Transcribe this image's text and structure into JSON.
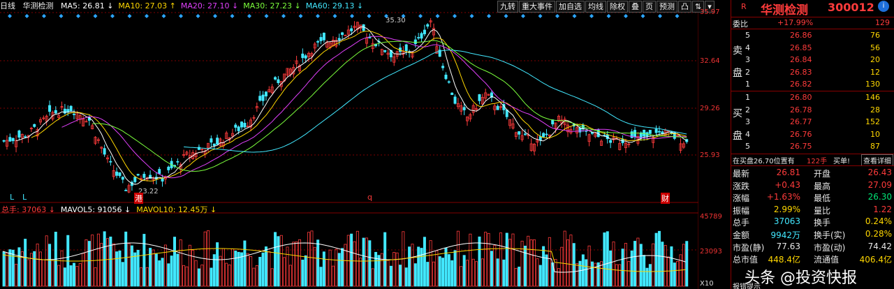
{
  "header": {
    "period": "日线",
    "name": "华测检测",
    "ma": [
      {
        "label": "MA5: 26.81",
        "arrow": "↓",
        "color": "#ffffff"
      },
      {
        "label": "MA10: 27.03",
        "arrow": "↑",
        "color": "#ffd700"
      },
      {
        "label": "MA20: 27.10",
        "arrow": "↓",
        "color": "#e040fb"
      },
      {
        "label": "MA30: 27.23",
        "arrow": "↓",
        "color": "#7cff3c"
      },
      {
        "label": "MA60: 29.13",
        "arrow": "↓",
        "color": "#42e8ff"
      }
    ]
  },
  "toolbar": [
    "九转",
    "重大事件",
    "加自选",
    "均线",
    "除权",
    "叠",
    "页",
    "预测",
    "凸",
    "⇅",
    "▾"
  ],
  "price_axis": {
    "labels": [
      "35.97",
      "32.64",
      "29.26",
      "25.93"
    ],
    "top": "35.97"
  },
  "vol_axis": {
    "labels": [
      "45789",
      "23093",
      "X10"
    ]
  },
  "annotations": {
    "high": "35.30",
    "low": "23.22",
    "L1": "L",
    "L2": "L",
    "gang": "港",
    "q": "q",
    "cai": "财"
  },
  "volume_header": [
    {
      "label": "总手: 37063",
      "arrow": "↓",
      "color": "#ff3b3b"
    },
    {
      "label": "MAVOL5: 91056",
      "arrow": "↓",
      "color": "#ffffff"
    },
    {
      "label": "MAVOL10: 12.45万",
      "arrow": "↓",
      "color": "#ffd700"
    }
  ],
  "quote": {
    "r": "R",
    "title": "华测检测",
    "code": "300012",
    "weibi_label": "委比",
    "weibi_value": "+17.99%",
    "weibi_diff": "129",
    "sell_label": [
      "卖",
      "盘"
    ],
    "buy_label": [
      "买",
      "盘"
    ],
    "sells": [
      {
        "n": "5",
        "price": "26.86",
        "vol": "76"
      },
      {
        "n": "4",
        "price": "26.85",
        "vol": "56"
      },
      {
        "n": "3",
        "price": "26.84",
        "vol": "20"
      },
      {
        "n": "2",
        "price": "26.83",
        "vol": "12"
      },
      {
        "n": "1",
        "price": "26.82",
        "vol": "130"
      }
    ],
    "buys": [
      {
        "n": "1",
        "price": "26.80",
        "vol": "146"
      },
      {
        "n": "2",
        "price": "26.78",
        "vol": "28"
      },
      {
        "n": "3",
        "price": "26.77",
        "vol": "152"
      },
      {
        "n": "4",
        "price": "26.76",
        "vol": "10"
      },
      {
        "n": "5",
        "price": "26.75",
        "vol": "87"
      }
    ],
    "position_note": "在买盘26.70位置有",
    "position_vol": "122手",
    "position_action": "买单!",
    "detail_link": "查看详细",
    "stats": [
      {
        "l1": "最新",
        "v1": "26.81",
        "c1": "red",
        "l2": "开盘",
        "v2": "26.43",
        "c2": "red"
      },
      {
        "l1": "涨跌",
        "v1": "+0.43",
        "c1": "red",
        "l2": "最高",
        "v2": "27.09",
        "c2": "red"
      },
      {
        "l1": "涨幅",
        "v1": "+1.63%",
        "c1": "red",
        "l2": "最低",
        "v2": "26.30",
        "c2": "green"
      },
      {
        "l1": "振幅",
        "v1": "2.99%",
        "c1": "yellow",
        "l2": "量比",
        "v2": "1.22",
        "c2": "red"
      },
      {
        "l1": "总手",
        "v1": "37063",
        "c1": "cyan",
        "l2": "换手",
        "v2": "0.24%",
        "c2": "yellow"
      },
      {
        "l1": "金额",
        "v1": "9942万",
        "c1": "cyan",
        "l2": "换手(实)",
        "v2": "0.28%",
        "c2": "yellow"
      },
      {
        "l1": "市盈(静)",
        "v1": "77.63",
        "c1": "white",
        "l2": "市盈(动)",
        "v2": "74.42",
        "c2": "white"
      },
      {
        "l1": "总市值",
        "v1": "448.4亿",
        "c1": "yellow",
        "l2": "流通值",
        "v2": "406.4亿",
        "c2": "yellow"
      }
    ],
    "footer": "报错提示"
  },
  "watermark": "头条 @投资快报",
  "colors": {
    "up": "#ff3b3b",
    "down": "#42e8ff",
    "grid": "#800000",
    "ma5": "#ffffff",
    "ma10": "#ffd700",
    "ma20": "#e040fb",
    "ma30": "#7cff3c",
    "ma60": "#42e8ff"
  }
}
